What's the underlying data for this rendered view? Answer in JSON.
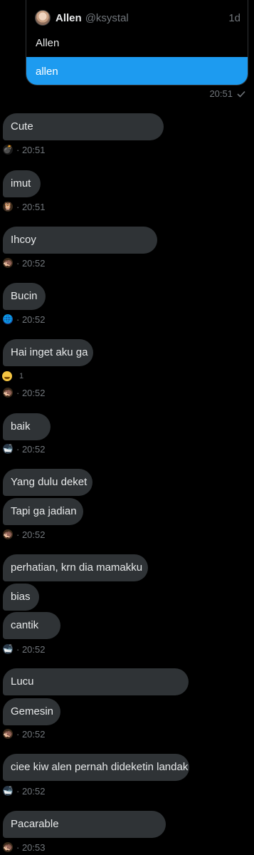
{
  "quoted": {
    "name": "Allen",
    "handle": "@ksystal",
    "age": "1d",
    "text": "Allen",
    "reply": "allen"
  },
  "sent_time": "20:51",
  "messages": [
    {
      "text": "Cute"
    },
    {
      "text": "imut"
    },
    {
      "text": "Ihcoy"
    },
    {
      "text": "Bucin"
    },
    {
      "text": "Hai inget aku ga"
    },
    {
      "text": "baik"
    },
    {
      "text": "Yang dulu deket"
    },
    {
      "text": "Tapi ga jadian"
    },
    {
      "text": "perhatian, krn dia mamakku"
    },
    {
      "text": "bias"
    },
    {
      "text": "cantik"
    },
    {
      "text": "Lucu"
    },
    {
      "text": "Gemesin"
    },
    {
      "text": "ciee kiw alen pernah dideketin landak"
    },
    {
      "text": "Pacarable"
    }
  ],
  "metas": [
    {
      "time": "· 20:51",
      "avatar_icon": "bomb-icon"
    },
    {
      "time": "· 20:51",
      "avatar_icon": "owl-icon"
    },
    {
      "time": "· 20:52",
      "avatar_icon": "hedgehog-icon"
    },
    {
      "time": "· 20:52",
      "avatar_icon": "globe-icon"
    },
    {
      "time": "· 20:52",
      "avatar_icon": "hedgehog-icon"
    },
    {
      "time": "· 20:52",
      "avatar_icon": "bathtub-icon"
    },
    {
      "time": "· 20:52",
      "avatar_icon": "hedgehog-icon"
    },
    {
      "time": "· 20:52",
      "avatar_icon": "bathtub-icon"
    },
    {
      "time": "· 20:52",
      "avatar_icon": "hedgehog-icon"
    },
    {
      "time": "· 20:52",
      "avatar_icon": "bathtub-icon"
    },
    {
      "time": "· 20:53",
      "avatar_icon": "hedgehog-icon"
    }
  ],
  "reaction": {
    "count": "1",
    "emoji_icon": "grinning-face-icon"
  },
  "colors": {
    "accent": "#1d9bf0",
    "bubble": "#2f3336",
    "muted": "#71767b"
  }
}
